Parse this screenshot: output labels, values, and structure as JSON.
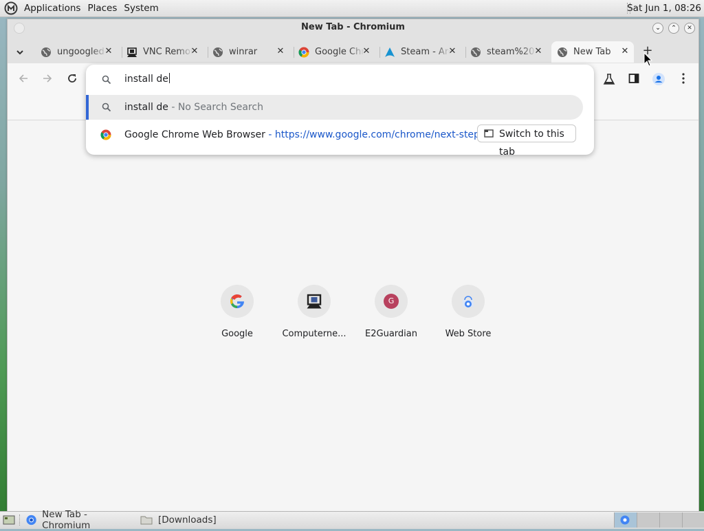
{
  "top_panel": {
    "menus": [
      "Applications",
      "Places",
      "System"
    ],
    "clock": "Sat Jun  1, 08:26"
  },
  "window": {
    "title": "New Tab - Chromium"
  },
  "tabs": [
    {
      "title": "ungoogled-chromium",
      "icon": "globe-icon"
    },
    {
      "title": "VNC Remote",
      "icon": "vnc-icon"
    },
    {
      "title": "winrar",
      "icon": "globe-icon"
    },
    {
      "title": "Google Chrome",
      "icon": "chrome-icon"
    },
    {
      "title": "Steam - Arch",
      "icon": "arch-icon"
    },
    {
      "title": "steam%20",
      "icon": "globe-icon"
    },
    {
      "title": "New Tab",
      "icon": "globe-icon",
      "active": true
    }
  ],
  "omnibox": {
    "input_value": "install de",
    "suggestions": [
      {
        "query": "install de",
        "description": "- No Search Search",
        "icon": "search-icon"
      },
      {
        "title": "Google Chrome Web Browser",
        "separator": "-",
        "url": "https://www.google.com/chrome/next-steps.h...",
        "icon": "chrome-icon",
        "action": "Switch to this tab"
      }
    ]
  },
  "shortcuts": [
    {
      "label": "Google"
    },
    {
      "label": "Computerne..."
    },
    {
      "label": "E2Guardian",
      "letter": "G"
    },
    {
      "label": "Web Store"
    }
  ],
  "taskbar": {
    "tasks": [
      "New Tab - Chromium",
      "[Downloads]"
    ]
  },
  "colors": {
    "accent": "#3367d6",
    "url": "#1a57c9",
    "e2guardian": "#b8415e"
  }
}
